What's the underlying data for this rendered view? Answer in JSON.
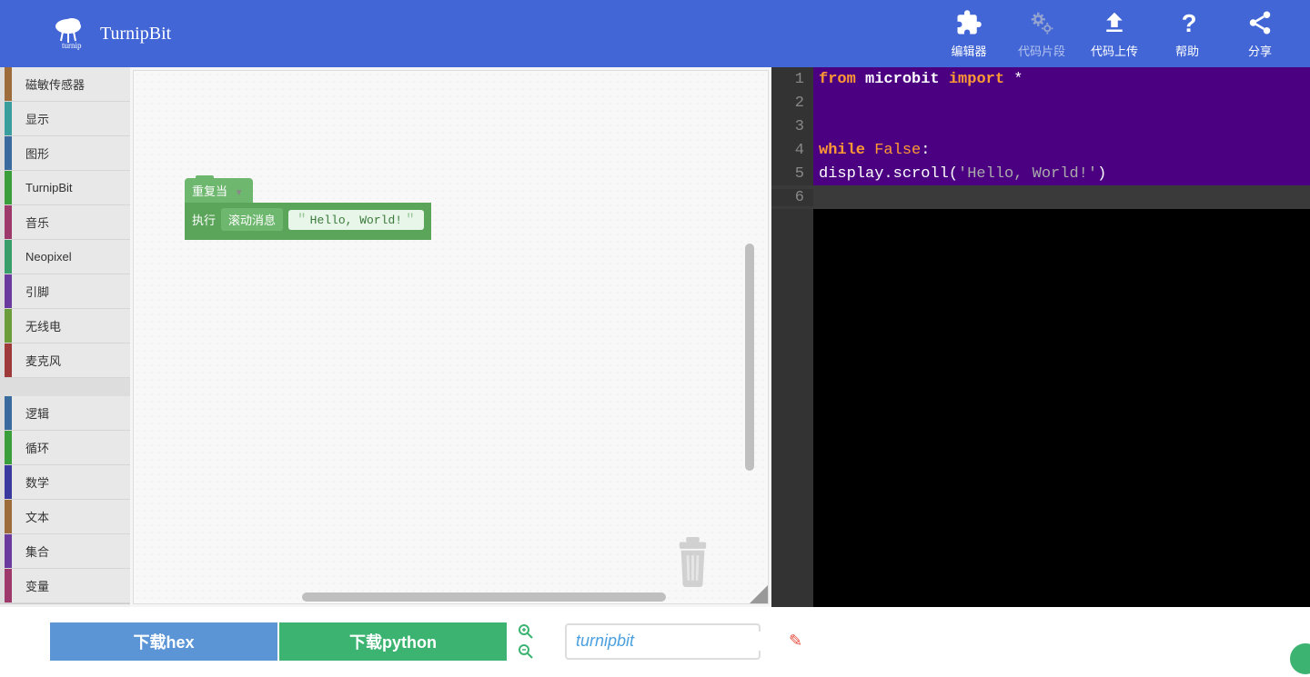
{
  "header": {
    "title": "TurnipBit",
    "nav": [
      {
        "label": "编辑器",
        "icon": "puzzle"
      },
      {
        "label": "代码片段",
        "icon": "gears"
      },
      {
        "label": "代码上传",
        "icon": "upload"
      },
      {
        "label": "帮助",
        "icon": "question"
      },
      {
        "label": "分享",
        "icon": "share"
      }
    ]
  },
  "sidebar": {
    "categories1": [
      {
        "label": "磁敏传感器",
        "color": "#9e6b3a"
      },
      {
        "label": "显示",
        "color": "#3a9e9e"
      },
      {
        "label": "图形",
        "color": "#3a6b9e"
      },
      {
        "label": "TurnipBit",
        "color": "#3a9e3a"
      },
      {
        "label": "音乐",
        "color": "#9e3a6b"
      },
      {
        "label": "Neopixel",
        "color": "#3a9e6b"
      },
      {
        "label": "引脚",
        "color": "#6b3a9e"
      },
      {
        "label": "无线电",
        "color": "#6b9e3a"
      },
      {
        "label": "麦克风",
        "color": "#9e3a3a"
      }
    ],
    "categories2": [
      {
        "label": "逻辑",
        "color": "#3a6b9e"
      },
      {
        "label": "循环",
        "color": "#3a9e3a"
      },
      {
        "label": "数学",
        "color": "#3a3a9e"
      },
      {
        "label": "文本",
        "color": "#9e6b3a"
      },
      {
        "label": "集合",
        "color": "#6b3a9e"
      },
      {
        "label": "变量",
        "color": "#9e3a6b"
      }
    ]
  },
  "blocks": {
    "loop_header": "重复当",
    "exec_label": "执行",
    "scroll_label": "滚动消息",
    "string_value": "Hello, World!"
  },
  "code": {
    "lines": [
      {
        "num": "1"
      },
      {
        "num": "2"
      },
      {
        "num": "3"
      },
      {
        "num": "4"
      },
      {
        "num": "5"
      },
      {
        "num": "6"
      }
    ],
    "line1_from": "from",
    "line1_mod": "microbit",
    "line1_import": "import",
    "line1_star": "*",
    "line4_while": "while",
    "line4_false": "False",
    "line4_colon": ":",
    "line5_indent": "  ",
    "line5_call": "display.scroll(",
    "line5_str": "'Hello, World!'",
    "line5_close": ")"
  },
  "footer": {
    "download_hex": "下载hex",
    "download_python": "下载python",
    "filename": "turnipbit"
  }
}
